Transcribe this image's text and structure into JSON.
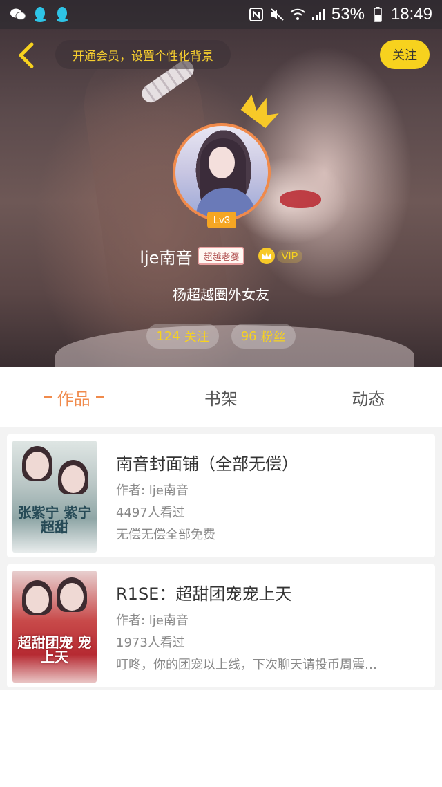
{
  "status_bar": {
    "left_icons": [
      "wechat-icon",
      "qq-icon",
      "qq-icon"
    ],
    "right_icons": [
      "nfc-icon",
      "mute-icon",
      "wifi-icon",
      "signal-icon"
    ],
    "battery": "53%",
    "time": "18:49"
  },
  "header": {
    "back_icon": "chevron-left-icon",
    "vip_banner": "开通会员，设置个性化背景",
    "follow_label": "关注"
  },
  "profile": {
    "level": "Lv3",
    "username": "lje南音",
    "title_tag": "超越老婆",
    "vip_label": "VIP",
    "signature": "杨超越圈外女友",
    "following_count": "124",
    "following_label": "关注",
    "fans_count": "96",
    "fans_label": "粉丝"
  },
  "tabs": [
    {
      "label": "作品",
      "active": true
    },
    {
      "label": "书架",
      "active": false
    },
    {
      "label": "动态",
      "active": false
    }
  ],
  "works": [
    {
      "title": "南音封面铺（全部无偿）",
      "author": "作者: lje南音",
      "views": "4497人看过",
      "desc": "无偿无偿全部免费",
      "cover_text": "张紫宁 紫宁超甜"
    },
    {
      "title": "R1SE：超甜团宠宠上天",
      "author": "作者: lje南音",
      "views": "1973人看过",
      "desc": "叮咚，你的团宠以上线，下次聊天请投币周震…",
      "cover_text": "超甜团宠 宠上天"
    }
  ],
  "colors": {
    "accent_orange": "#f08a4b",
    "accent_yellow": "#f7d21e"
  }
}
